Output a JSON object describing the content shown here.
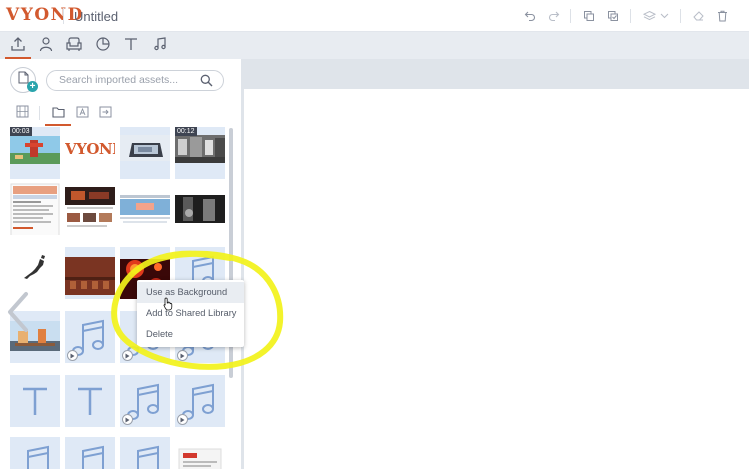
{
  "app": {
    "logo": "VYOND",
    "document_title": "Untitled"
  },
  "toolbar": {
    "icons": [
      "undo-icon",
      "redo-icon",
      "copy-icon",
      "paste-icon",
      "layers-icon",
      "chevron-down-icon",
      "clear-icon",
      "delete-icon"
    ]
  },
  "tabs": [
    {
      "name": "import",
      "icon": "upload-icon",
      "active": true
    },
    {
      "name": "characters",
      "icon": "person-icon",
      "active": false
    },
    {
      "name": "props",
      "icon": "armchair-icon",
      "active": false
    },
    {
      "name": "charts",
      "icon": "pie-chart-icon",
      "active": false
    },
    {
      "name": "text",
      "icon": "text-icon",
      "active": false
    },
    {
      "name": "audio",
      "icon": "music-icon",
      "active": false
    }
  ],
  "search": {
    "placeholder": "Search imported assets..."
  },
  "filters": [
    {
      "name": "all",
      "icon": "film-icon",
      "active": false
    },
    {
      "name": "folders",
      "icon": "folder-icon",
      "active": true
    },
    {
      "name": "fonts",
      "icon": "font-icon",
      "active": false
    },
    {
      "name": "export",
      "icon": "move-to-icon",
      "active": false
    }
  ],
  "assets": [
    {
      "kind": "video",
      "duration": "00:03",
      "thumb": "scene-outdoor"
    },
    {
      "kind": "image",
      "thumb": "vyond-logo",
      "text": "VYOND"
    },
    {
      "kind": "image",
      "thumb": "laptop-photo"
    },
    {
      "kind": "video",
      "duration": "00:12",
      "thumb": "street-photo"
    },
    {
      "kind": "image",
      "thumb": "webpage-screenshot"
    },
    {
      "kind": "image",
      "thumb": "dark-webpage"
    },
    {
      "kind": "image",
      "thumb": "banner-screenshot"
    },
    {
      "kind": "image",
      "thumb": "bw-street"
    },
    {
      "kind": "image",
      "thumb": "japan-map"
    },
    {
      "kind": "image",
      "thumb": "brick-wall"
    },
    {
      "kind": "image",
      "thumb": "red-abstract"
    },
    {
      "kind": "audio",
      "thumb": "music"
    },
    {
      "kind": "image",
      "thumb": "office-scene"
    },
    {
      "kind": "audio",
      "thumb": "music"
    },
    {
      "kind": "audio",
      "thumb": "music"
    },
    {
      "kind": "audio",
      "thumb": "music"
    },
    {
      "kind": "text",
      "thumb": "text"
    },
    {
      "kind": "text",
      "thumb": "text"
    },
    {
      "kind": "audio",
      "thumb": "music"
    },
    {
      "kind": "audio",
      "thumb": "music"
    },
    {
      "kind": "audio",
      "thumb": "music"
    },
    {
      "kind": "audio",
      "thumb": "music"
    },
    {
      "kind": "audio",
      "thumb": "music"
    },
    {
      "kind": "image",
      "thumb": "webpage-small"
    }
  ],
  "context_menu": {
    "items": [
      {
        "label": "Use as Background",
        "hovered": true
      },
      {
        "label": "Add to Shared Library",
        "hovered": false
      },
      {
        "label": "Delete",
        "hovered": false
      }
    ]
  },
  "colors": {
    "brand": "#d2592e",
    "accent": "#2aa4ac",
    "tile_bg": "#dfe9f6",
    "icon_blue": "#7ea0d2",
    "highlight": "#f2f21a"
  }
}
